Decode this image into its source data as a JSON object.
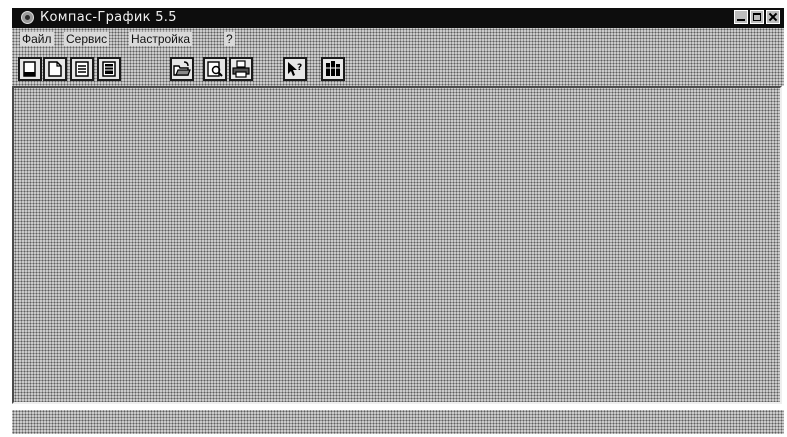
{
  "window": {
    "title": "Компас-График 5.5",
    "app_icon": "kompas-app-icon",
    "controls": [
      "minimize-icon",
      "maximize-icon",
      "close-icon"
    ]
  },
  "menubar": {
    "items": [
      {
        "label": "Файл"
      },
      {
        "label": "Сервис"
      },
      {
        "label": "Настройка"
      },
      {
        "label": "?"
      }
    ]
  },
  "toolbar": {
    "buttons": [
      {
        "icon": "new-sheet-icon"
      },
      {
        "icon": "new-fragment-icon"
      },
      {
        "icon": "new-text-document-icon"
      },
      {
        "icon": "new-specification-icon"
      },
      {
        "icon": "open-file-icon"
      },
      {
        "icon": "print-preview-icon"
      },
      {
        "icon": "print-icon"
      },
      {
        "icon": "help-pointer-icon"
      },
      {
        "icon": "library-icon"
      }
    ]
  },
  "statusbar": {
    "text": ""
  }
}
